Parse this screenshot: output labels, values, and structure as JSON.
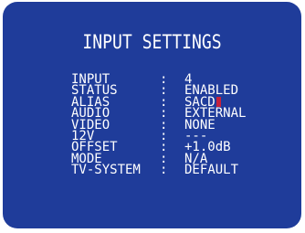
{
  "screen": {
    "title": "INPUT SETTINGS",
    "cursor_color": "#c4213d",
    "rows": [
      {
        "label": "INPUT",
        "sep": ":",
        "value": "4"
      },
      {
        "label": "STATUS",
        "sep": ":",
        "value": "ENABLED"
      },
      {
        "label": "ALIAS",
        "sep": ":",
        "value": "SACD"
      },
      {
        "label": "AUDIO",
        "sep": ":",
        "value": "EXTERNAL"
      },
      {
        "label": "VIDEO",
        "sep": ":",
        "value": "NONE"
      },
      {
        "label": "12V",
        "sep": ":",
        "value": "---"
      },
      {
        "label": "OFFSET",
        "sep": ":",
        "value": "+1.0dB"
      },
      {
        "label": "MODE",
        "sep": ":",
        "value": "N/A"
      },
      {
        "label": "TV-SYSTEM",
        "sep": ":",
        "value": "DEFAULT"
      }
    ]
  }
}
